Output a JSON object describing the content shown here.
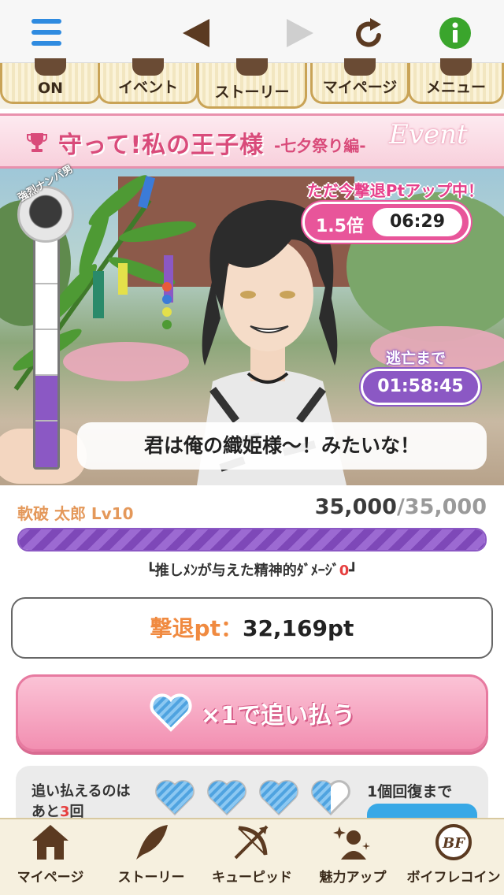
{
  "toolbar": {
    "menu_icon": "hamburger-icon",
    "back_icon": "back-triangle-icon",
    "forward_icon": "forward-triangle-icon",
    "reload_icon": "reload-icon",
    "info_icon": "info-icon",
    "colors": {
      "menu": "#2f8be0",
      "back": "#5b3a21",
      "forward": "#cfcfcf",
      "reload": "#5b3a21",
      "info": "#3aa52c"
    }
  },
  "menu_tabs": [
    {
      "label": "ON"
    },
    {
      "label": "イベント"
    },
    {
      "label": "ストーリー"
    },
    {
      "label": "マイページ"
    },
    {
      "label": "メニュー"
    }
  ],
  "banner": {
    "title": "守って!私の王子様",
    "subtitle": "-七夕祭り編-",
    "event": "Event"
  },
  "scene": {
    "gauge_label": "強烈ナンパ男",
    "gauge_level": 0.4,
    "bonus_text": "ただ今撃退Ptアップ中！",
    "bonus_multiplier": "1.5倍",
    "bonus_timer": "06:29",
    "escape_label": "逃亡まで",
    "escape_timer": "01:58:45",
    "speech": "君は俺の織姫様〜！みたいな！"
  },
  "enemy": {
    "name": "軟破 太郎 Lv10",
    "hp_current": "35,000",
    "hp_max": "/35,000",
    "hp_ratio": 1.0,
    "damage_label": "┗推しﾒﾝが与えた精神的ﾀﾞﾒｰｼﾞ",
    "damage_value": "0",
    "damage_end": "┛"
  },
  "points": {
    "label": "撃退pt：",
    "value": "32,169pt"
  },
  "chase_button": {
    "label": "×1で追い払う",
    "icon": "heart-icon"
  },
  "stamina": {
    "line1": "追い払えるのは",
    "line2_prefix": "あと",
    "count": "3",
    "line2_suffix": "回",
    "hearts": [
      1,
      1,
      1,
      0.5
    ],
    "recovery_label": "1個回復まで"
  },
  "bottom_nav": [
    {
      "label": "マイページ",
      "icon": "home-icon"
    },
    {
      "label": "ストーリー",
      "icon": "quill-icon"
    },
    {
      "label": "キューピッド",
      "icon": "bow-arrow-icon"
    },
    {
      "label": "魅力アップ",
      "icon": "sparkle-person-icon"
    },
    {
      "label": "ボイフレコイン",
      "icon": "bf-coin-icon"
    }
  ]
}
